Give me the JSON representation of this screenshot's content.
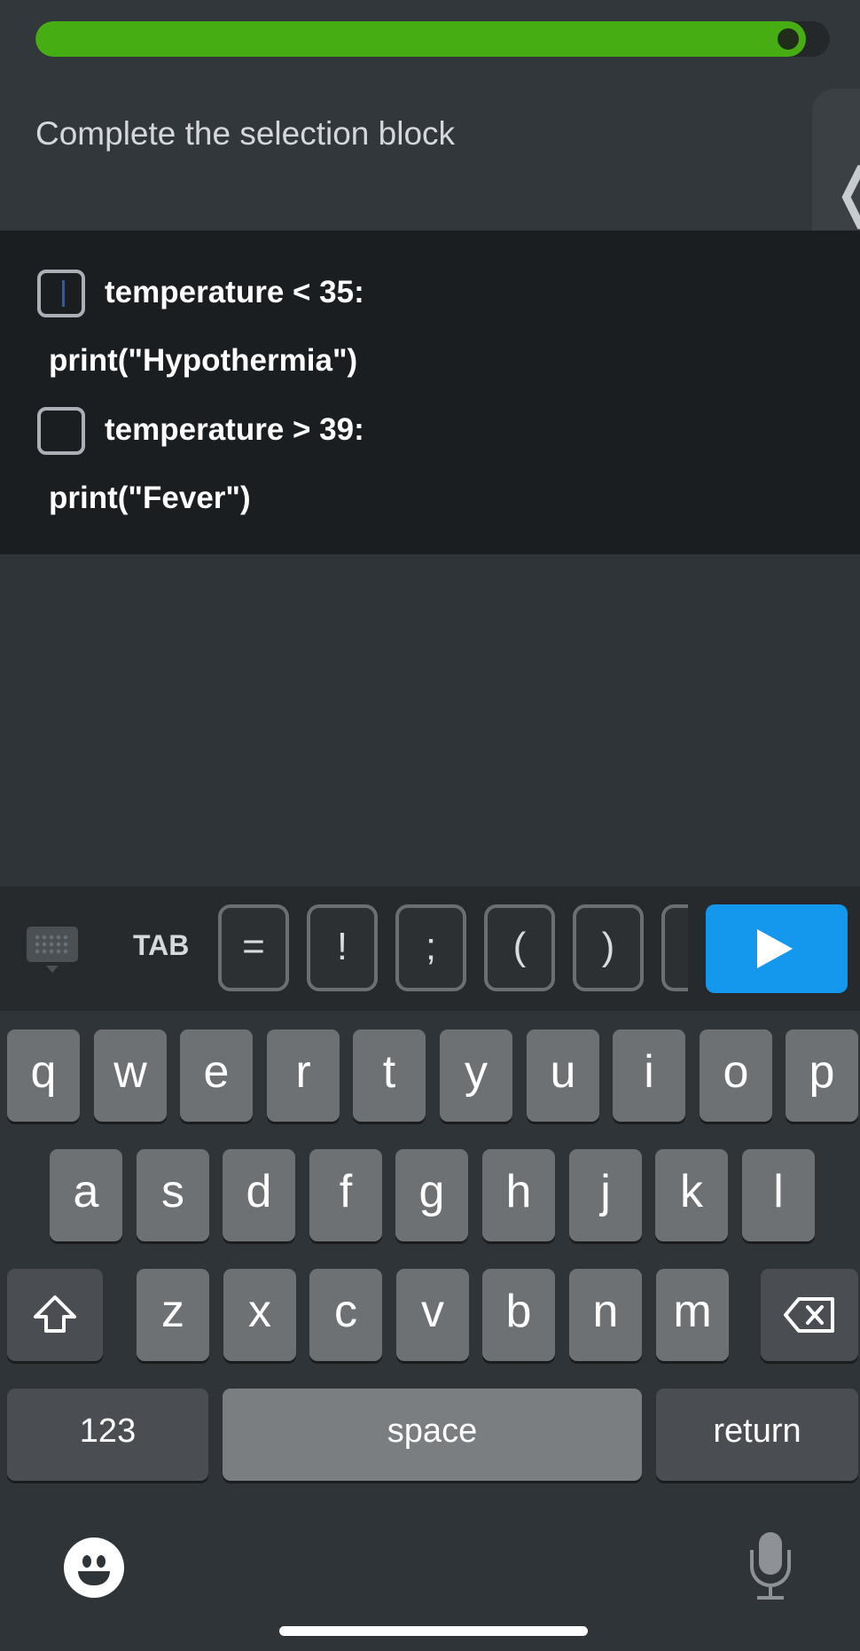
{
  "progress": {
    "fraction": 0.97
  },
  "question": {
    "text": "Complete the selection block"
  },
  "side_panel": {
    "icon": "chevron-left-icon",
    "glyph": "❬"
  },
  "code": {
    "lines": [
      {
        "text": "temperature < 35:",
        "has_blank": true,
        "blank_active": true
      },
      {
        "text": "print(\"Hypothermia\")",
        "has_blank": false
      },
      {
        "text": "temperature > 39:",
        "has_blank": true,
        "blank_active": false
      },
      {
        "text": "print(\"Fever\")",
        "has_blank": false
      }
    ]
  },
  "toolbar": {
    "keyboard_icon": "keyboard-hide-icon",
    "tab_label": "TAB",
    "symbols": [
      "=",
      "!",
      ";",
      "(",
      ")"
    ],
    "run_icon": "play-icon"
  },
  "keyboard": {
    "row1": [
      "q",
      "w",
      "e",
      "r",
      "t",
      "y",
      "u",
      "i",
      "o",
      "p"
    ],
    "row2": [
      "a",
      "s",
      "d",
      "f",
      "g",
      "h",
      "j",
      "k",
      "l"
    ],
    "row3": [
      "z",
      "x",
      "c",
      "v",
      "b",
      "n",
      "m"
    ],
    "shift_icon": "shift-icon",
    "delete_icon": "delete-icon",
    "numbers_label": "123",
    "space_label": "space",
    "return_label": "return",
    "emoji_icon": "emoji-icon",
    "mic_icon": "microphone-icon"
  },
  "colors": {
    "progress": "#46ad12",
    "run_button": "#1398ee",
    "code_background": "#1b1e21",
    "key": "#6e7174"
  }
}
